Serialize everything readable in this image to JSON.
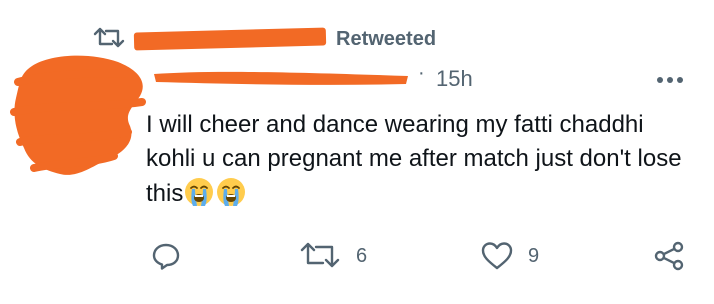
{
  "tweet": {
    "retweet_label": "Retweeted",
    "timestamp": "15h",
    "separator": "·",
    "text": "I will cheer and dance wearing my fatti chaddhi kohli u can pregnant me after match just don't lose this",
    "emoji": [
      "loudly-crying-face",
      "loudly-crying-face"
    ],
    "redactions": [
      "retweeter-name",
      "author-avatar",
      "author-name"
    ],
    "redaction_color": "#f26a25"
  },
  "actions": {
    "reply_count": "",
    "retweet_count": "6",
    "like_count": "9"
  },
  "icons": [
    "retweet-icon",
    "more-icon",
    "reply-icon",
    "retweet-icon",
    "heart-icon",
    "share-icon"
  ]
}
